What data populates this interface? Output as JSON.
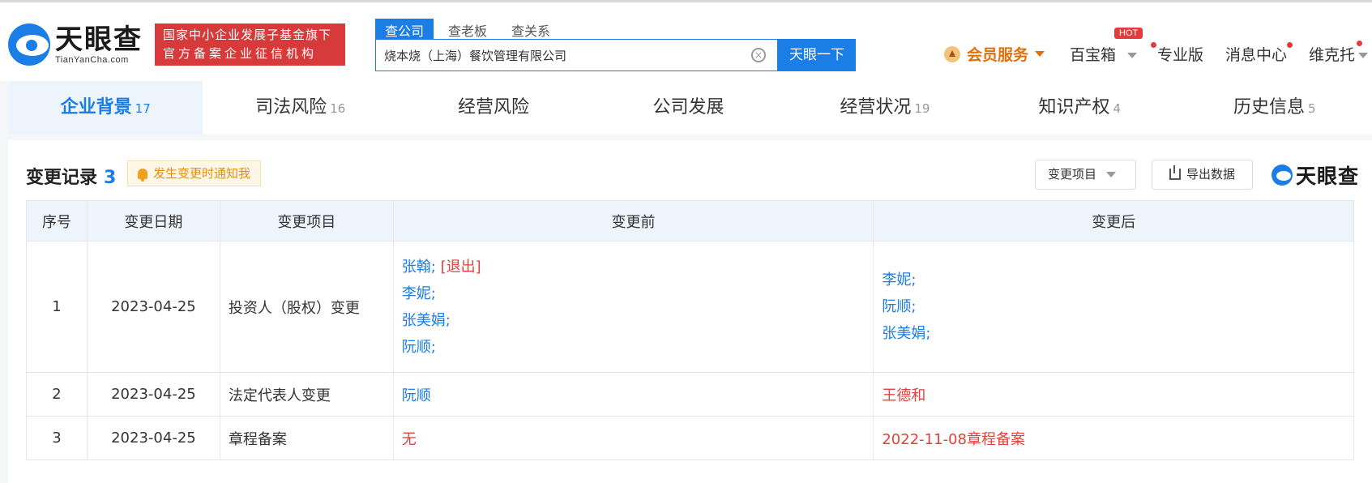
{
  "logo": {
    "cn": "天眼查",
    "en": "TianYanCha.com"
  },
  "fund_badge": {
    "line1": "国家中小企业发展子基金旗下",
    "line2": "官方备案企业征信机构"
  },
  "search": {
    "tabs": [
      {
        "label": "查公司",
        "active": true
      },
      {
        "label": "查老板",
        "active": false
      },
      {
        "label": "查关系",
        "active": false
      }
    ],
    "value": "烧本烧（上海）餐饮管理有限公司",
    "button": "天眼一下"
  },
  "nav": {
    "vip": "会员服务",
    "treasure": "百宝箱",
    "hot": "HOT",
    "pro": "专业版",
    "messages": "消息中心",
    "user": "维克托"
  },
  "tabs": [
    {
      "label": "企业背景",
      "count": "17",
      "active": true
    },
    {
      "label": "司法风险",
      "count": "16",
      "active": false
    },
    {
      "label": "经营风险",
      "count": "",
      "active": false
    },
    {
      "label": "公司发展",
      "count": "",
      "active": false
    },
    {
      "label": "经营状况",
      "count": "19",
      "active": false
    },
    {
      "label": "知识产权",
      "count": "4",
      "active": false
    },
    {
      "label": "历史信息",
      "count": "5",
      "active": false
    }
  ],
  "section": {
    "title": "变更记录",
    "count": "3",
    "notify": "发生变更时通知我",
    "filter": "变更项目",
    "export": "导出数据",
    "watermark": "天眼查"
  },
  "table": {
    "headers": [
      "序号",
      "变更日期",
      "变更项目",
      "变更前",
      "变更后"
    ],
    "rows": [
      {
        "index": "1",
        "date": "2023-04-25",
        "item": "投资人（股权）变更",
        "before": [
          "张翰;",
          "[退出]",
          "李妮;",
          "张美娟;",
          "阮顺;"
        ],
        "after": [
          "李妮;",
          "阮顺;",
          "张美娟;"
        ]
      },
      {
        "index": "2",
        "date": "2023-04-25",
        "item": "法定代表人变更",
        "before": [
          "阮顺"
        ],
        "after": [
          "王德和"
        ]
      },
      {
        "index": "3",
        "date": "2023-04-25",
        "item": "章程备案",
        "before": [
          "无"
        ],
        "after": [
          "2022-11-08章程备案"
        ]
      }
    ]
  },
  "colors": {
    "accent": "#1a7ee6",
    "red": "#e0433b",
    "badge": "#d63a3a",
    "vip": "#e0700a"
  }
}
